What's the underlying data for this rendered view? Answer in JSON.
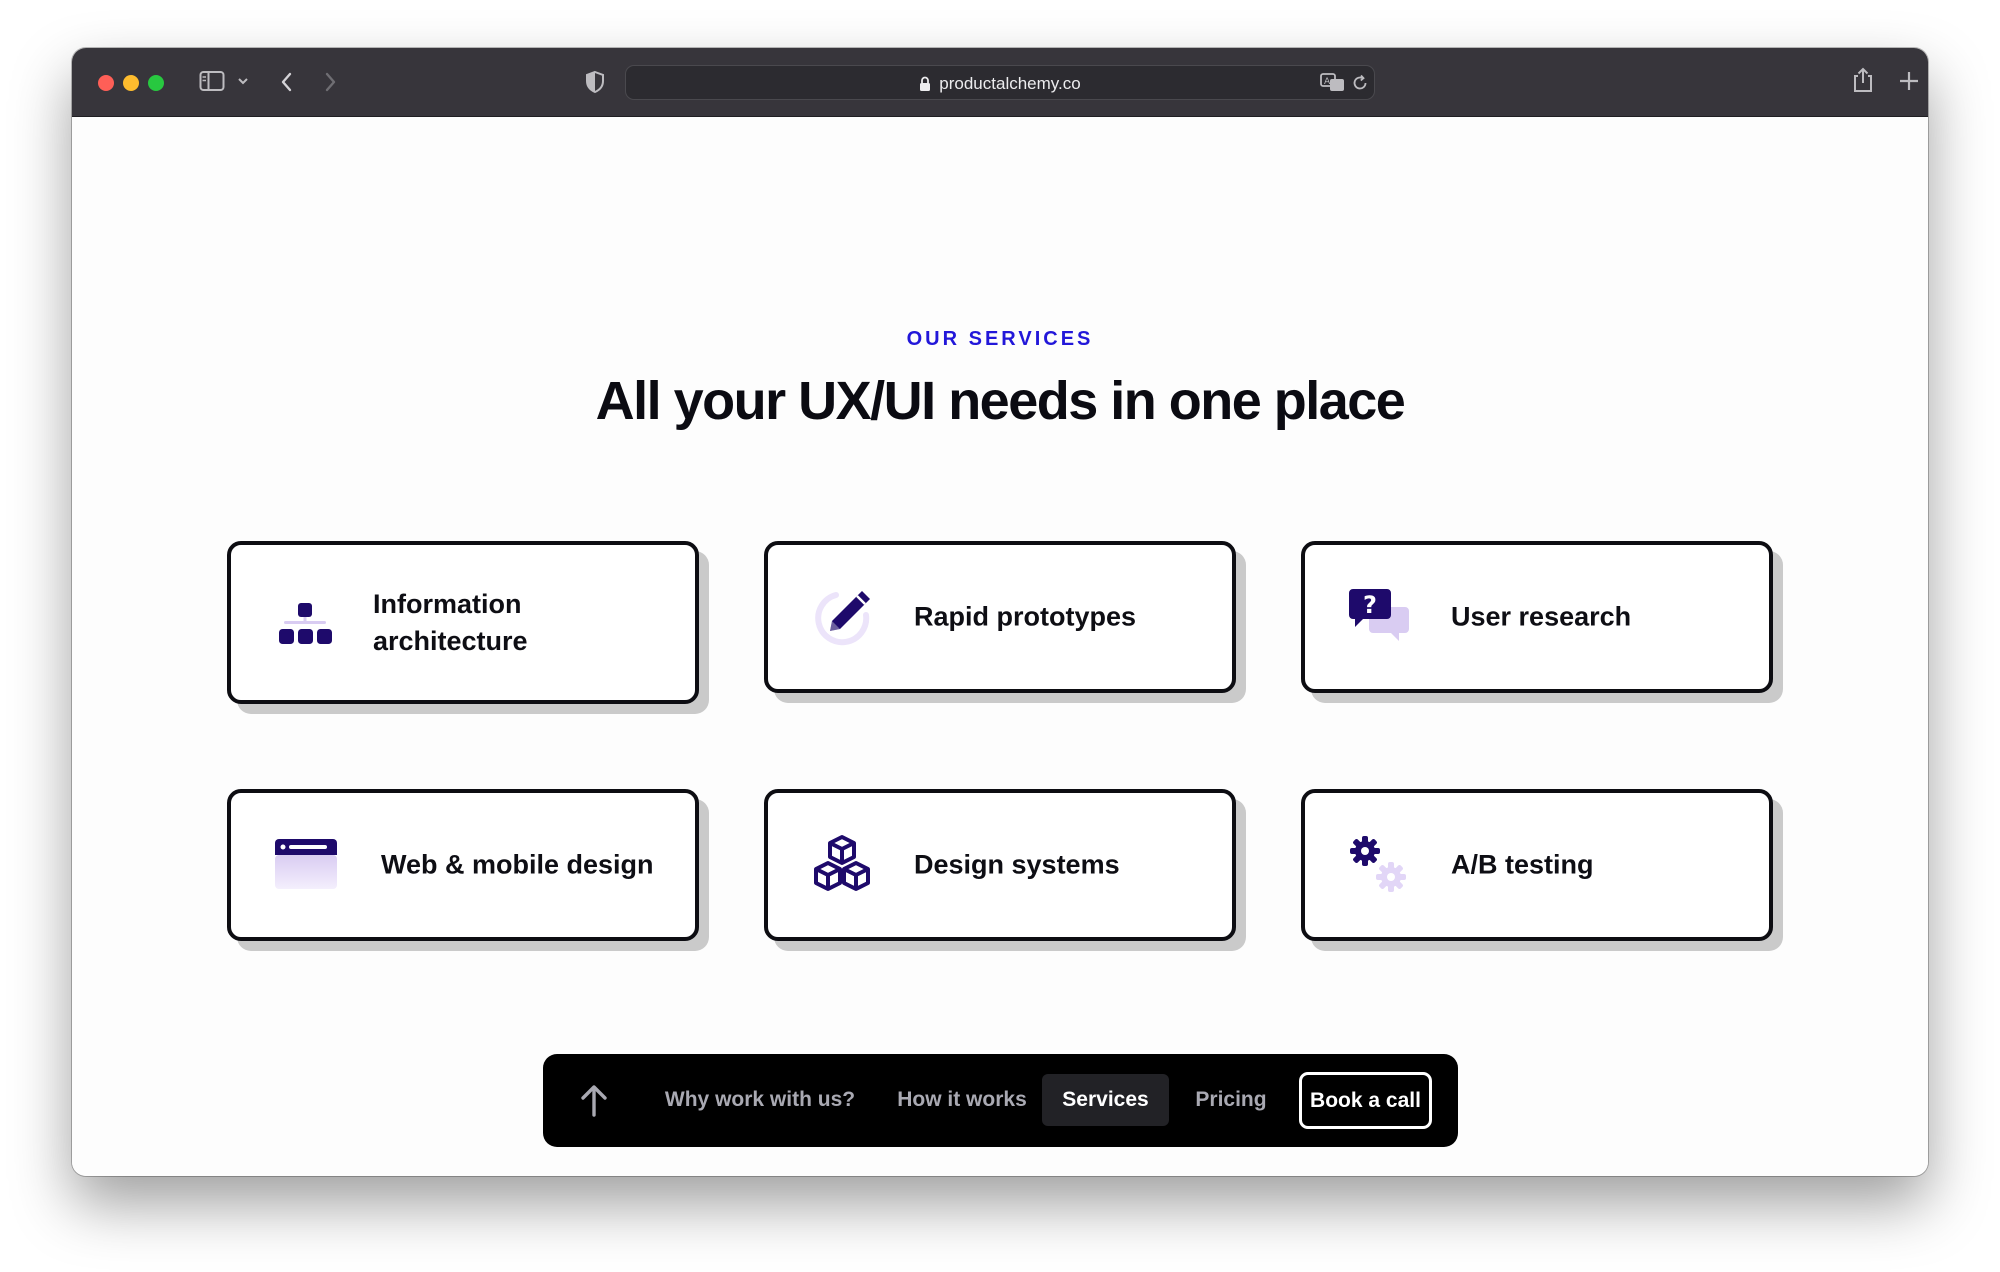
{
  "browser": {
    "url": "productalchemy.co",
    "colors": {
      "chrome": "#37353b",
      "close": "#fe5f57",
      "minimize": "#febc2e",
      "maximize": "#28c840"
    },
    "icons": [
      "sidebar-icon",
      "chevron-down-icon",
      "back-icon",
      "forward-icon",
      "shield-icon",
      "lock-icon",
      "translate-icon",
      "reload-icon",
      "share-icon",
      "new-tab-icon",
      "tab-overview-icon"
    ]
  },
  "section": {
    "eyebrow": "OUR SERVICES",
    "title": "All your UX/UI needs in one place"
  },
  "services": [
    {
      "label": "Information architecture",
      "icon": "sitemap-icon"
    },
    {
      "label": "Rapid prototypes",
      "icon": "pencil-icon"
    },
    {
      "label": "User research",
      "icon": "question-chat-icon"
    },
    {
      "label": "Web & mobile design",
      "icon": "browser-window-icon"
    },
    {
      "label": "Design systems",
      "icon": "cubes-icon"
    },
    {
      "label": "A/B testing",
      "icon": "gears-icon"
    }
  ],
  "nav": {
    "up_icon": "arrow-up-icon",
    "items": [
      {
        "label": "Why work with us?"
      },
      {
        "label": "How it works"
      },
      {
        "label": "Services",
        "active": true
      },
      {
        "label": "Pricing"
      }
    ],
    "cta": "Book a call"
  },
  "colors": {
    "accent": "#2217d9",
    "icon_primary": "#1e0a6b",
    "icon_secondary": "#d9ccf2",
    "card_shadow": "#cacaca",
    "navbar": "#000000"
  }
}
